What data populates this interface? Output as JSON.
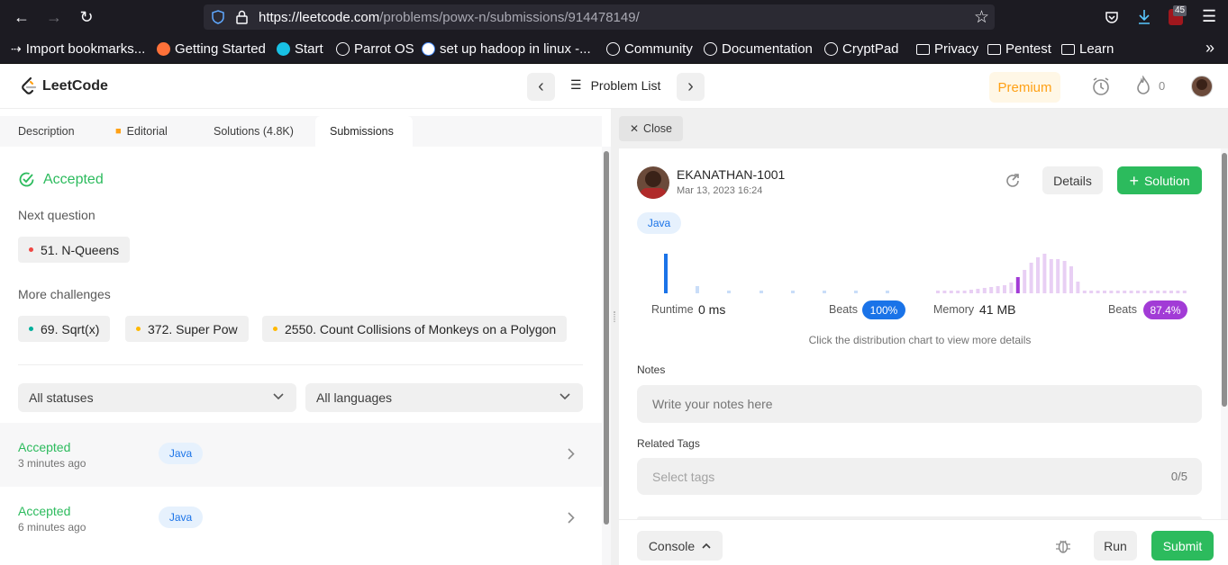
{
  "browser": {
    "url_host": "https://leetcode.com",
    "url_path": "/problems/powx-n/submissions/914478149/",
    "extension_badge": "45",
    "bookmarks": [
      "Import bookmarks...",
      "Getting Started",
      "Start",
      "Parrot OS",
      "set up hadoop in linux -...",
      "Community",
      "Documentation",
      "CryptPad",
      "Privacy",
      "Pentest",
      "Learn"
    ]
  },
  "header": {
    "logo": "LeetCode",
    "problem_list": "Problem List",
    "premium": "Premium",
    "streak_count": "0"
  },
  "tabs": {
    "description": "Description",
    "editorial": "Editorial",
    "solutions": "Solutions (4.8K)",
    "submissions": "Submissions"
  },
  "left": {
    "status": "Accepted",
    "next_question_label": "Next question",
    "next_question": "51. N-Queens",
    "more_challenges_label": "More challenges",
    "challenges": [
      "69. Sqrt(x)",
      "372. Super Pow",
      "2550. Count Collisions of Monkeys on a Polygon"
    ],
    "filter_status": "All statuses",
    "filter_language": "All languages",
    "submissions": [
      {
        "status": "Accepted",
        "time": "3 minutes ago",
        "lang": "Java"
      },
      {
        "status": "Accepted",
        "time": "6 minutes ago",
        "lang": "Java"
      }
    ]
  },
  "right": {
    "close": "Close",
    "username": "EKANATHAN-1001",
    "date": "Mar 13, 2023 16:24",
    "details": "Details",
    "solution": "Solution",
    "language": "Java",
    "runtime_label": "Runtime",
    "runtime_value": "0 ms",
    "beats_label": "Beats",
    "runtime_beats": "100%",
    "memory_label": "Memory",
    "memory_value": "41 MB",
    "memory_beats": "87.4%",
    "chart_hint": "Click the distribution chart to view more details",
    "notes_label": "Notes",
    "notes_placeholder": "Write your notes here",
    "tags_label": "Related Tags",
    "tags_placeholder": "Select tags",
    "tags_count": "0/5"
  },
  "bottom": {
    "console": "Console",
    "run": "Run",
    "submit": "Submit"
  },
  "colors": {
    "accepted": "#2cbb5d",
    "brand_orange": "#ffa116",
    "runtime_bar": "#1a73e8",
    "memory_bar": "#a23bd6"
  }
}
